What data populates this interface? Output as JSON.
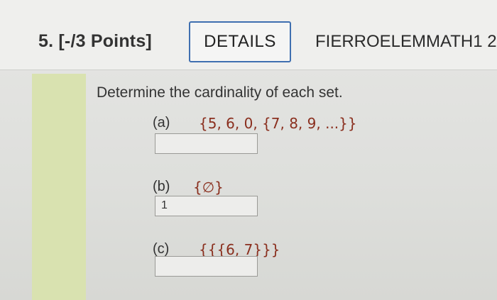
{
  "header": {
    "question_number": "5. [-/3 Points]",
    "details_label": "DETAILS",
    "course_code": "FIERROELEMMATH1 2."
  },
  "question": {
    "prompt": "Determine the cardinality of each set.",
    "parts": [
      {
        "label": "(a)",
        "set": "{5, 6, 0, {7, 8, 9, ...}}",
        "answer": ""
      },
      {
        "label": "(b)",
        "set": "{∅}",
        "answer": "1"
      },
      {
        "label": "(c)",
        "set": "{{{6, 7}}}",
        "answer": ""
      }
    ]
  },
  "colors": {
    "details_border": "#3f6fb0",
    "set_text": "#8a2f1e",
    "left_bar": "#d9e2b0"
  }
}
